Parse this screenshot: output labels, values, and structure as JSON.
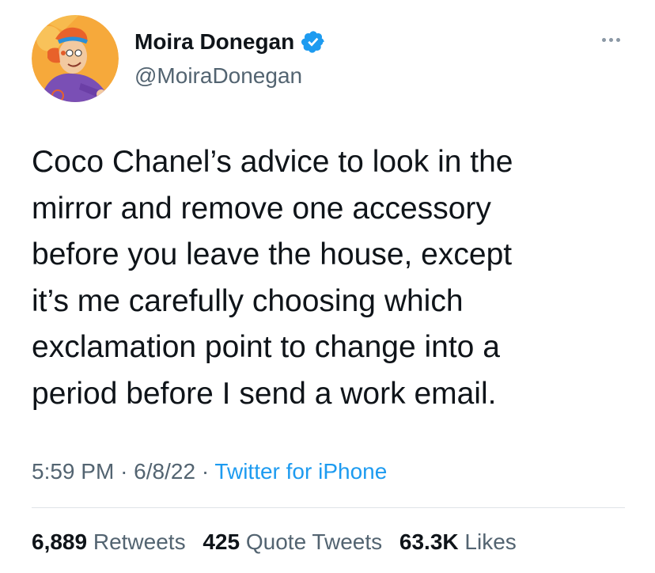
{
  "user": {
    "display_name": "Moira Donegan",
    "handle": "@MoiraDonegan",
    "verified": true,
    "avatar_icon": "cartoon-avatar-icon",
    "verified_icon": "verified-badge-icon"
  },
  "tweet": {
    "text_lines": [
      "Coco Chanel’s advice to look in the",
      "mirror and remove one accessory",
      "before you leave the house, except",
      "it’s me carefully choosing which",
      "exclamation point to change into a",
      "period before I send a work email."
    ],
    "time": "5:59 PM",
    "date": "6/8/22",
    "separator": "·",
    "source": "Twitter for iPhone"
  },
  "stats": {
    "retweets_count": "6,889",
    "retweets_label": "Retweets",
    "quote_tweets_count": "425",
    "quote_tweets_label": "Quote Tweets",
    "likes_count": "63.3K",
    "likes_label": "Likes"
  },
  "colors": {
    "text_primary": "#0f1419",
    "text_secondary": "#536471",
    "link": "#1d9bf0",
    "verified": "#1d9bf0",
    "divider": "#dfe3e7"
  }
}
